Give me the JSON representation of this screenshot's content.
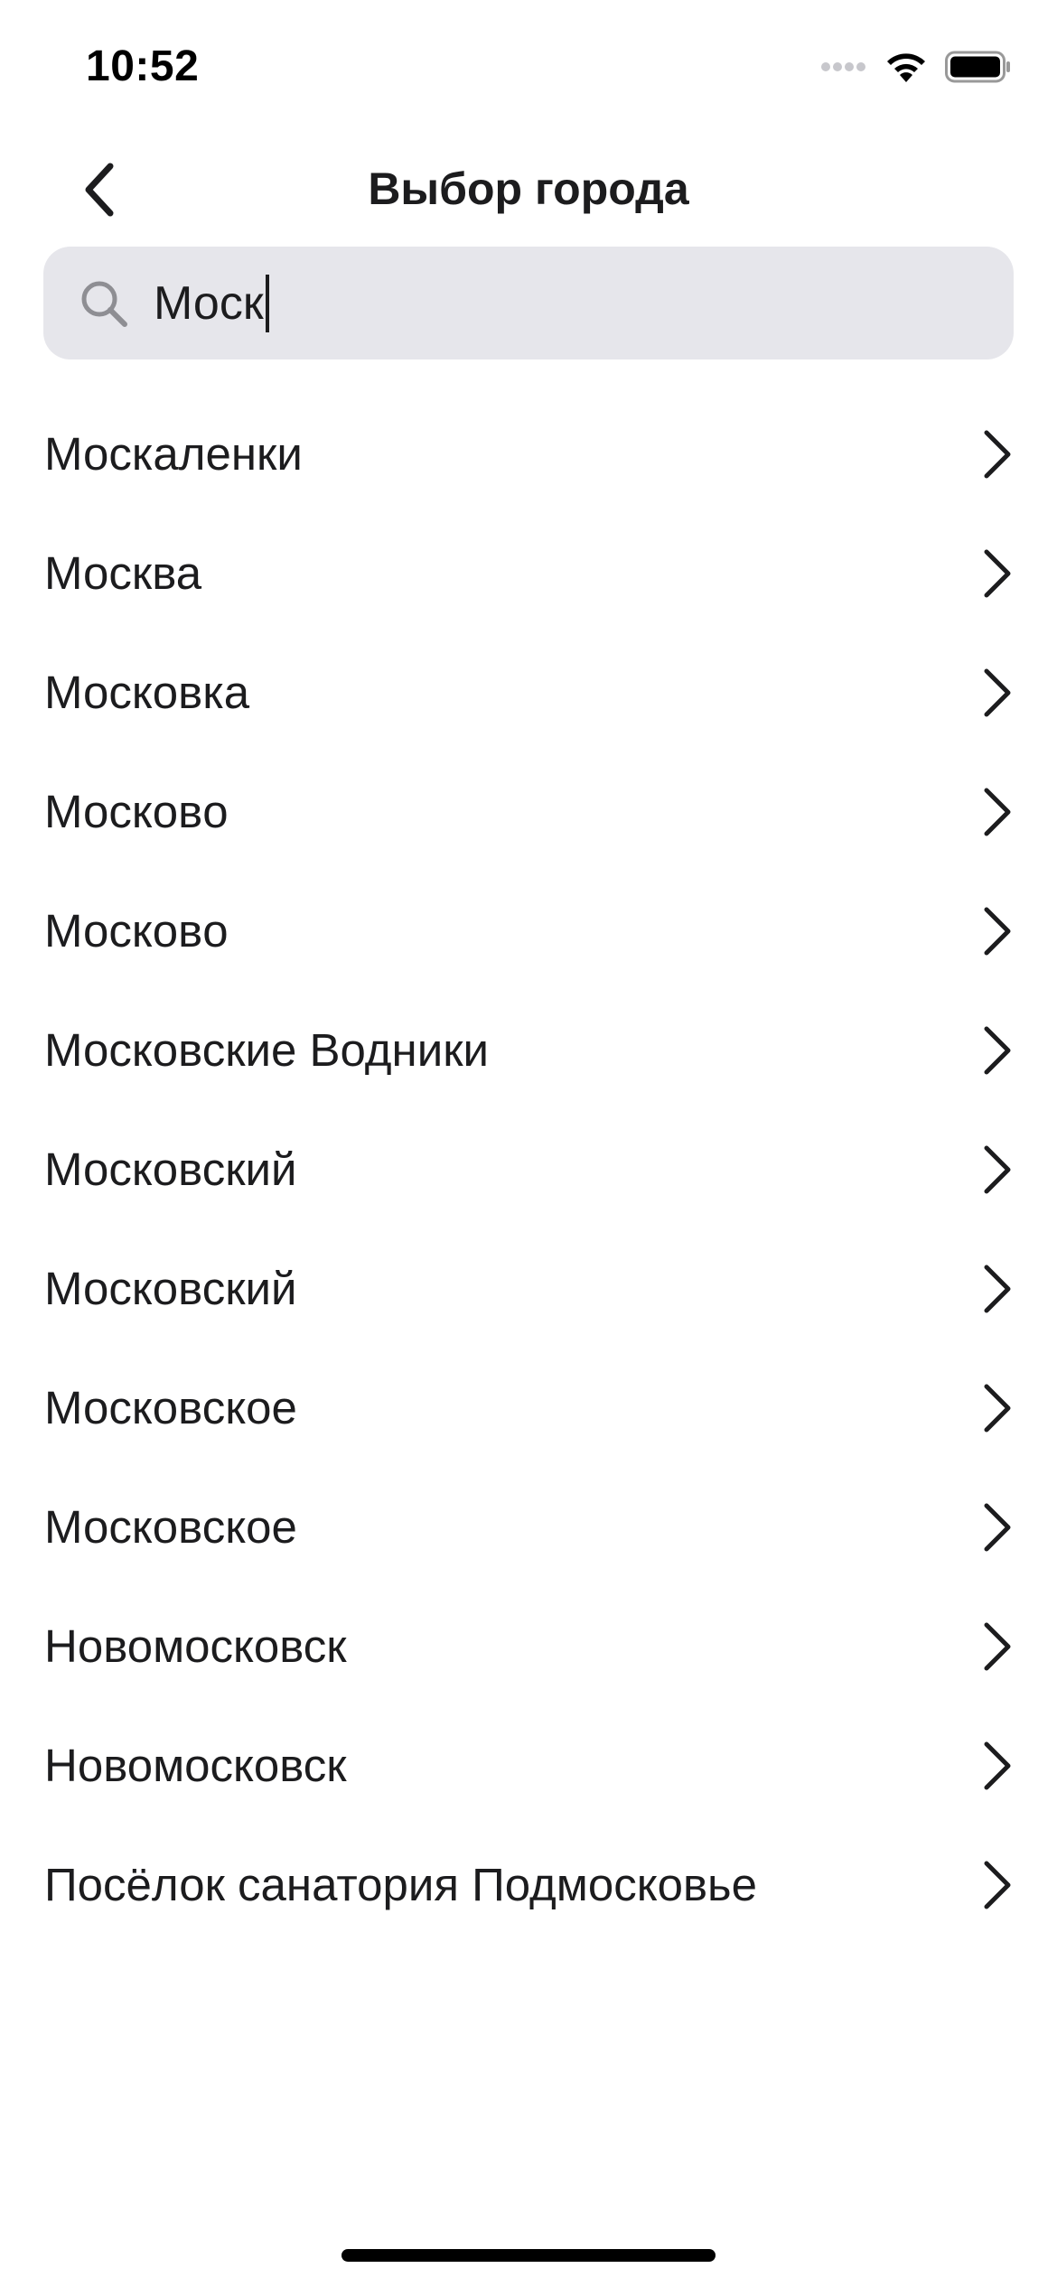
{
  "status_bar": {
    "time": "10:52"
  },
  "nav": {
    "title": "Выбор города",
    "back_icon": "chevron-left-icon"
  },
  "search": {
    "value": "Моск",
    "icon": "search-icon"
  },
  "cities": [
    "Москаленки",
    "Москва",
    "Московка",
    "Московo",
    "Московo",
    "Московские Водники",
    "Московский",
    "Московский",
    "Московское",
    "Московское",
    "Новомосковск",
    "Новомосковск",
    "Посёлок санатория Подмосковье"
  ],
  "colors": {
    "text": "#1c1c1e",
    "search_bg": "#e6e6eb",
    "icon_gray": "#8e8e93",
    "background": "#ffffff"
  }
}
